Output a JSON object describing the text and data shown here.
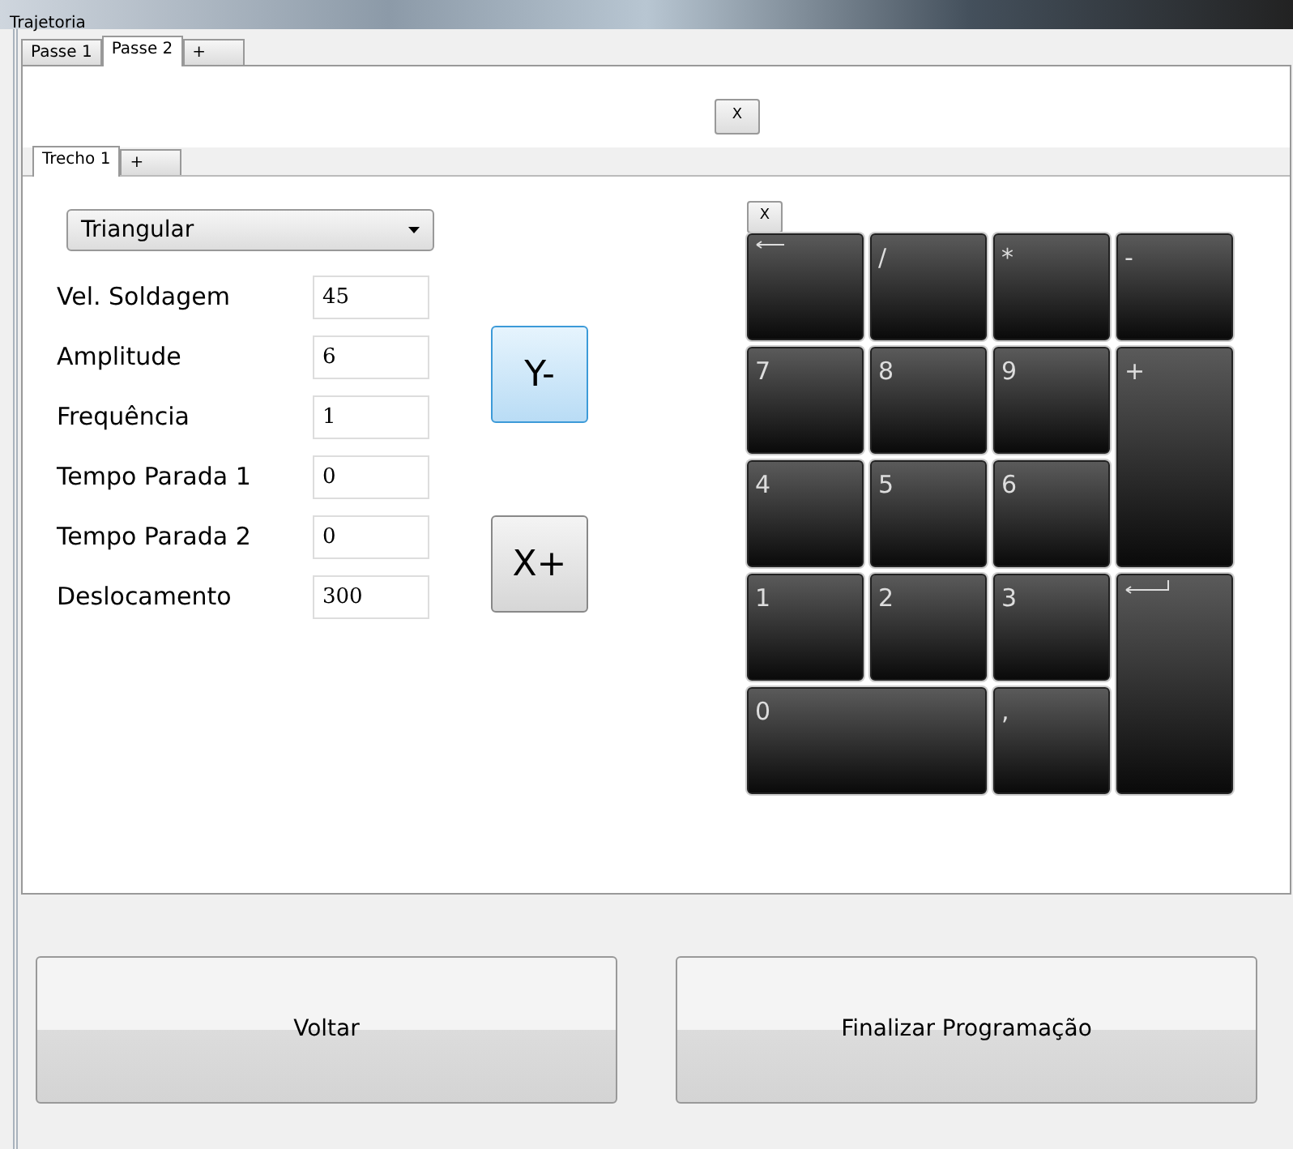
{
  "window": {
    "title": "Trajetoria"
  },
  "tabs": [
    {
      "label": "Passe 1",
      "selected": false
    },
    {
      "label": "Passe 2",
      "selected": true
    },
    {
      "label": "+",
      "selected": false
    }
  ],
  "close_button": "X",
  "sub_tabs": [
    {
      "label": "Trecho 1",
      "selected": true
    },
    {
      "label": "+",
      "selected": false
    }
  ],
  "pattern_dropdown": {
    "value": "Triangular"
  },
  "fields": [
    {
      "label": "Vel. Soldagem",
      "value": "45"
    },
    {
      "label": "Amplitude",
      "value": "6"
    },
    {
      "label": "Frequência",
      "value": "1"
    },
    {
      "label": "Tempo Parada 1",
      "value": "0"
    },
    {
      "label": "Tempo Parada 2",
      "value": "0"
    },
    {
      "label": "Deslocamento",
      "value": "300"
    }
  ],
  "jog_buttons": [
    {
      "label": "Y-",
      "selected": true
    },
    {
      "label": "X+",
      "selected": false
    }
  ],
  "keypad": {
    "close_button": "X",
    "keys": [
      {
        "kind": "backspace"
      },
      {
        "kind": "text",
        "label": "/"
      },
      {
        "kind": "text",
        "label": "*"
      },
      {
        "kind": "text",
        "label": "-"
      },
      {
        "kind": "text",
        "label": "7"
      },
      {
        "kind": "text",
        "label": "8"
      },
      {
        "kind": "text",
        "label": "9"
      },
      {
        "kind": "text",
        "label": "+",
        "tall": true
      },
      {
        "kind": "text",
        "label": "4"
      },
      {
        "kind": "text",
        "label": "5"
      },
      {
        "kind": "text",
        "label": "6"
      },
      {
        "kind": "text",
        "label": "1"
      },
      {
        "kind": "text",
        "label": "2"
      },
      {
        "kind": "text",
        "label": "3"
      },
      {
        "kind": "enter",
        "tall": true
      },
      {
        "kind": "text",
        "label": "0",
        "wide": true
      },
      {
        "kind": "text",
        "label": ","
      }
    ]
  },
  "footer_buttons": [
    "Voltar",
    "Finalizar Programação"
  ]
}
